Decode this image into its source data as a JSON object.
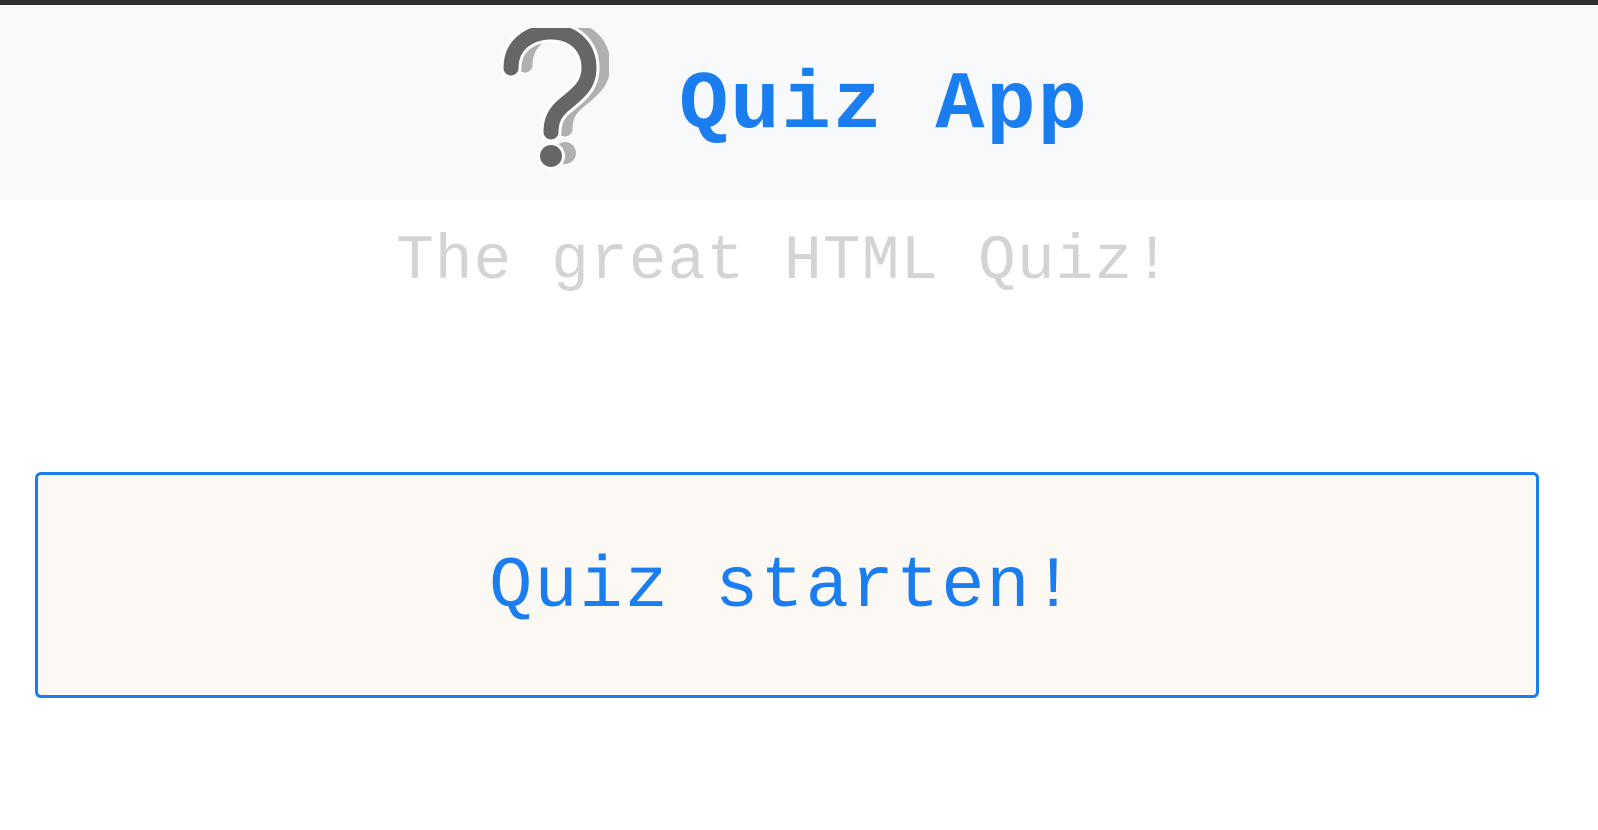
{
  "header": {
    "title": "Quiz App",
    "logo_icon": "question-mark-icon"
  },
  "main": {
    "subtitle": "The great HTML Quiz!",
    "start_button_label": "Quiz starten!"
  },
  "colors": {
    "accent": "#1a7df0",
    "header_background": "#f8f9fa",
    "subtitle_text": "#d4d4d4",
    "button_background": "#fcf9f4",
    "icon_dark": "#666666",
    "icon_shadow": "#b0b0b0"
  }
}
